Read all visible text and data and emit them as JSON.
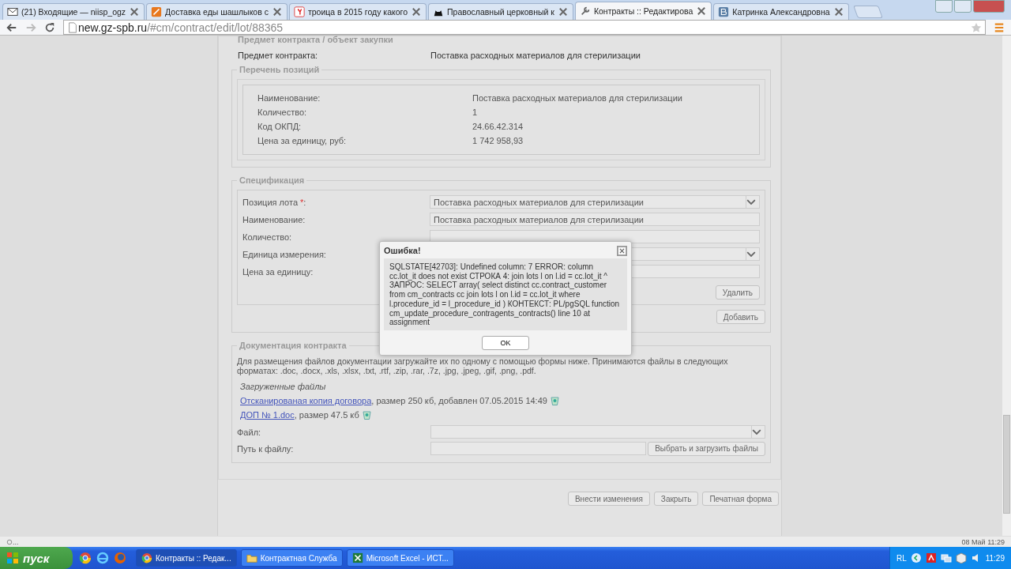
{
  "browser": {
    "tabs": [
      {
        "label": "(21) Входящие — niisp_ogz",
        "kind": "mail",
        "selected": false
      },
      {
        "label": "Доставка еды шашлыков с",
        "kind": "food",
        "selected": false
      },
      {
        "label": "троица в 2015 году какого",
        "kind": "search",
        "selected": false
      },
      {
        "label": "Православный церковный к",
        "kind": "cat",
        "selected": false
      },
      {
        "label": "Контракты :: Редактирова",
        "kind": "tools",
        "selected": true
      },
      {
        "label": "Катринка Александровна",
        "kind": "vk",
        "selected": false
      }
    ],
    "url_host": "new.gz-spb.ru",
    "url_path": "/#cm/contract/edit/lot/88365"
  },
  "page": {
    "section_title": "Предмет контракта / объект закупки",
    "subject_label": "Предмет контракта:",
    "subject_value": "Поставка расходных материалов для стерилизации",
    "positions": {
      "legend": "Перечень позиций",
      "rows": [
        {
          "label": "Наименование:",
          "value": "Поставка расходных материалов для стерилизации"
        },
        {
          "label": "Количество:",
          "value": "1"
        },
        {
          "label": "Код ОКПД:",
          "value": "24.66.42.314"
        },
        {
          "label": "Цена за единицу, руб:",
          "value": "1 742 958,93"
        }
      ]
    },
    "specification": {
      "legend": "Спецификация",
      "fields": [
        {
          "label": "Позиция лота ",
          "required_mark": "*",
          "suffix": ":",
          "kind": "select",
          "value": "Поставка расходных материалов для стерилизации"
        },
        {
          "label": "Наименование:",
          "kind": "text",
          "value": "Поставка расходных материалов для стерилизации"
        },
        {
          "label": "Количество:",
          "kind": "text"
        },
        {
          "label": "Единица измерения:",
          "kind": "select"
        },
        {
          "label": "Цена за единицу:",
          "kind": "text"
        }
      ],
      "delete_button": "Удалить",
      "add_button": "Добавить"
    },
    "documentation": {
      "legend": "Документация контракта",
      "description": "Для размещения файлов документации загружайте их по одному с помощью формы ниже. Принимаются файлы в следующих форматах: .doc, .docx, .xls, .xlsx, .txt, .rtf, .zip, .rar, .7z, .jpg, .jpeg, .gif, .png, .pdf.",
      "uploaded_heading": "Загруженные файлы",
      "files": [
        {
          "link": "Отсканированая копия договора",
          "details": ", размер 250 кб, добавлен 07.05.2015 14:49"
        },
        {
          "link": "ДОП  №  1.doc",
          "details": ", размер 47.5 кб"
        }
      ],
      "file_label": "Файл:",
      "path_label": "Путь к файлу:",
      "upload_button": "Выбрать и загрузить файлы"
    },
    "actions": [
      "Внести изменения",
      "Закрыть",
      "Печатная форма"
    ]
  },
  "dialog": {
    "title": "Ошибка!",
    "message": "SQLSTATE[42703]: Undefined column: 7 ERROR: column cc.lot_it does not exist СТРОКА 4: join lots l on l.id = cc.lot_it ^ ЗАПРОС: SELECT array( select distinct cc.contract_customer from cm_contracts cc join lots l on l.id = cc.lot_it where l.procedure_id = l_procedure_id ) КОНТЕКСТ: PL/pgSQL function cm_update_procedure_contragents_contracts() line 10 at assignment",
    "ok": "OK"
  },
  "status_bar": {
    "left": "...",
    "right": "08 Май 11:29"
  },
  "taskbar": {
    "start": "пуск",
    "tasks": [
      {
        "label": "Контракты :: Редак...",
        "kind": "browser",
        "selected": true
      },
      {
        "label": "Контрактная Служба",
        "kind": "folder",
        "selected": false
      },
      {
        "label": "Microsoft Excel - ИСТ...",
        "kind": "sheet",
        "selected": false
      }
    ],
    "language": "RL",
    "clock": "11:29"
  }
}
